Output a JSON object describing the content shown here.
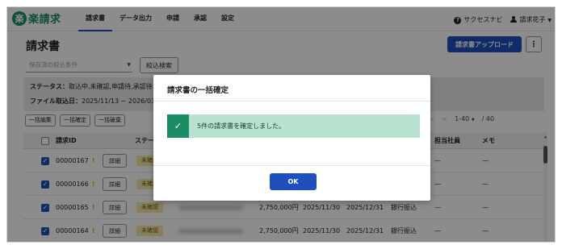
{
  "app": {
    "logo_mark": "楽",
    "logo_text": "楽請求"
  },
  "nav": {
    "items": [
      {
        "label": "請求書",
        "active": true
      },
      {
        "label": "データ出力",
        "active": false
      },
      {
        "label": "申請",
        "active": false
      },
      {
        "label": "承認",
        "active": false
      },
      {
        "label": "設定",
        "active": false
      }
    ],
    "help_label": "サクセスナビ",
    "help_icon": "help-icon",
    "user_name": "請求花子",
    "user_icon": "user-icon"
  },
  "page": {
    "title": "請求書",
    "upload_button": "請求書アップロード",
    "more_button": "⋮",
    "saved_filter_placeholder": "保存済の絞込条件",
    "filter_button": "絞込検索",
    "status_label": "ステータス：",
    "status_value": "取込中,未確認,申請待,承認待…",
    "import_label": "ファイル取込日：",
    "import_value": "2025/11/13 ~ 2026/03/…"
  },
  "bulk": {
    "buttons": [
      "一括編集",
      "一括確定",
      "一括破棄"
    ]
  },
  "pager": {
    "range": "1-40",
    "total": "/ 40"
  },
  "table": {
    "headers": {
      "id": "請求ID",
      "status": "ステータス",
      "staff": "担当社員",
      "memo": "メモ"
    },
    "detail_label": "詳細",
    "rows": [
      {
        "id": "00000167",
        "flag": "!",
        "status": "未確認",
        "amount": "",
        "date1": "",
        "date2": "",
        "method": "",
        "staff": "—",
        "memo": "—"
      },
      {
        "id": "00000166",
        "flag": "!",
        "status": "未確認",
        "amount": "",
        "date1": "",
        "date2": "",
        "method": "",
        "staff": "—",
        "memo": "—"
      },
      {
        "id": "00000165",
        "flag": "!",
        "status": "未確認",
        "amount": "2,750,000円",
        "date1": "2025/11/30",
        "date2": "2025/12/31",
        "method": "銀行振込",
        "staff": "—",
        "memo": "—"
      },
      {
        "id": "00000164",
        "flag": "!",
        "status": "未確認",
        "amount": "2,750,000円",
        "date1": "2025/11/30",
        "date2": "2025/12/31",
        "method": "銀行振込",
        "staff": "—",
        "memo": "—"
      }
    ]
  },
  "modal": {
    "title": "請求書の一括確定",
    "success_icon": "check-icon",
    "message": "5件の請求書を確定しました。",
    "ok_button": "OK"
  },
  "colors": {
    "brand_green": "#1b8c64",
    "primary_blue": "#1f4fbf",
    "success_bg": "#b7e2cf",
    "warn_yellow": "#e0a400"
  }
}
